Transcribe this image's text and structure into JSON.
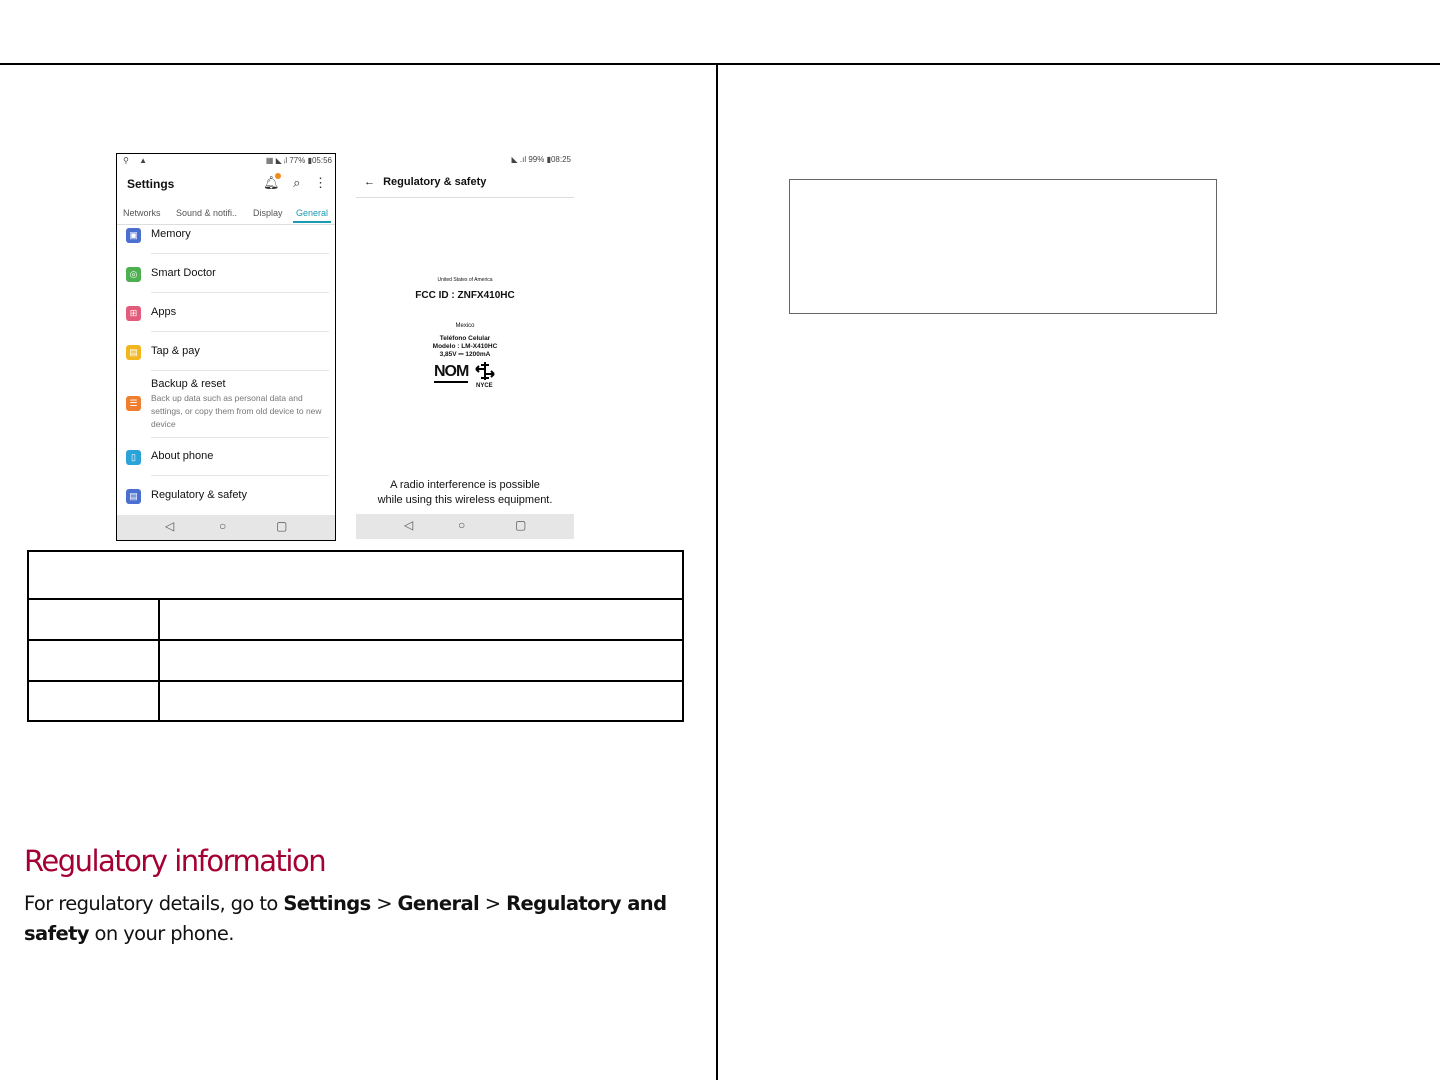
{
  "phone1": {
    "status_left": "⚲ ▲",
    "status_right": "▦ ◣ ᵢl 77% ▮05:56",
    "title": "Settings",
    "icons": [
      "bell-icon",
      "search-icon",
      "more-icon"
    ],
    "tabs": [
      "Networks",
      "Sound & notifi..",
      "Display",
      "General"
    ],
    "active_tab": "General",
    "items": [
      {
        "label": "Memory",
        "icon": "memory-icon",
        "color": "#4a6fd1"
      },
      {
        "label": "Smart Doctor",
        "icon": "smart-doctor-icon",
        "color": "#4caf50"
      },
      {
        "label": "Apps",
        "icon": "apps-icon",
        "color": "#e25b7a"
      },
      {
        "label": "Tap & pay",
        "icon": "tap-pay-icon",
        "color": "#f2b61f"
      },
      {
        "label": "Backup & reset",
        "sub": "Back up data such as personal data and settings, or copy them from old device to new device",
        "icon": "backup-icon",
        "color": "#ef7f2e"
      },
      {
        "label": "About phone",
        "icon": "about-phone-icon",
        "color": "#29a3d8"
      },
      {
        "label": "Regulatory & safety",
        "icon": "regulatory-icon",
        "color": "#4a6fd1"
      }
    ],
    "nav": [
      "◁",
      "○",
      "▢"
    ]
  },
  "phone2": {
    "status_right": "◣ .ıl 99% ▮08:25",
    "back": "←",
    "title": "Regulatory & safety",
    "usa_label": "United States of America",
    "fcc": "FCC ID : ZNFX410HC",
    "mexico_label": "Mexico",
    "telefono": "Teléfono Celular",
    "modelo": "Modelo : LM-X410HC",
    "rating": "3,85V ⎓ 1200mA",
    "nom": "NOM",
    "nyce": "NYCE",
    "notice_line1": "A radio interference is possible",
    "notice_line2": "while using this wireless equipment.",
    "nav": [
      "◁",
      "○",
      "▢"
    ]
  },
  "section": {
    "heading": "Regulatory information",
    "para_prefix": "For regulatory details, go to ",
    "settings": "Settings",
    "sep1": " > ",
    "general": "General",
    "sep2": " > ",
    "regulatory": "Regulatory and safety",
    "para_suffix": " on your phone."
  }
}
